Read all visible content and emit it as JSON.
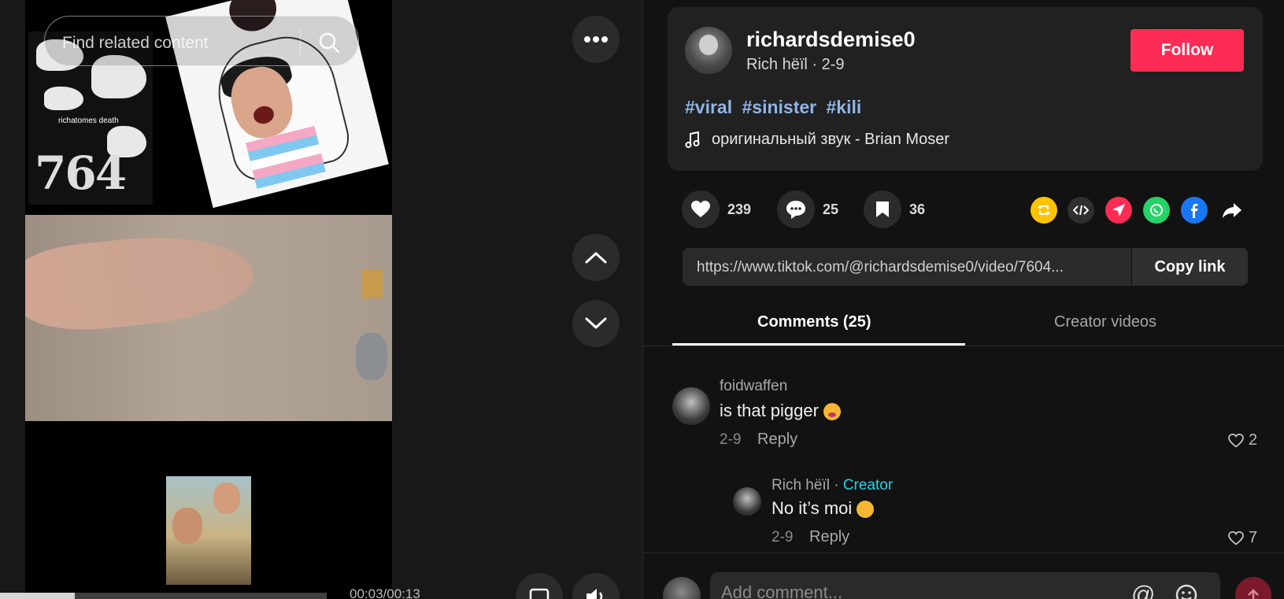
{
  "video": {
    "search_placeholder": "Find related content",
    "poster_text": "richatomes death",
    "poster_number": "764",
    "time": "00:03/00:13",
    "progress": 0.23
  },
  "author": {
    "username": "richardsdemise0",
    "display": "Rich hëïl · 2-9",
    "follow_label": "Follow"
  },
  "caption": {
    "hashtags": [
      "#viral",
      "#sinister",
      "#kili"
    ],
    "sound": "оригинальный звук - Brian Moser"
  },
  "actions": {
    "likes": "239",
    "comments": "25",
    "saves": "36"
  },
  "share": {
    "url": "https://www.tiktok.com/@richardsdemise0/video/7604...",
    "copy_label": "Copy link",
    "icons": [
      "repost-icon",
      "embed-icon",
      "send-icon",
      "whatsapp-icon",
      "facebook-icon",
      "share-arrow-icon"
    ],
    "colors": {
      "repost": "#ffc300",
      "send": "#fe2c55",
      "whatsapp": "#25d366",
      "facebook": "#1877f2"
    }
  },
  "tabs": {
    "comments": "Comments (25)",
    "creator_videos": "Creator videos"
  },
  "comments": [
    {
      "user": "foidwaffen",
      "text": "is that pigger",
      "date": "2-9",
      "reply": "Reply",
      "likes": "2"
    },
    {
      "user": "Rich hëïl",
      "creator_tag": "Creator",
      "text": "No it’s moi",
      "date": "2-9",
      "reply": "Reply",
      "likes": "7"
    }
  ],
  "composer": {
    "placeholder": "Add comment..."
  }
}
